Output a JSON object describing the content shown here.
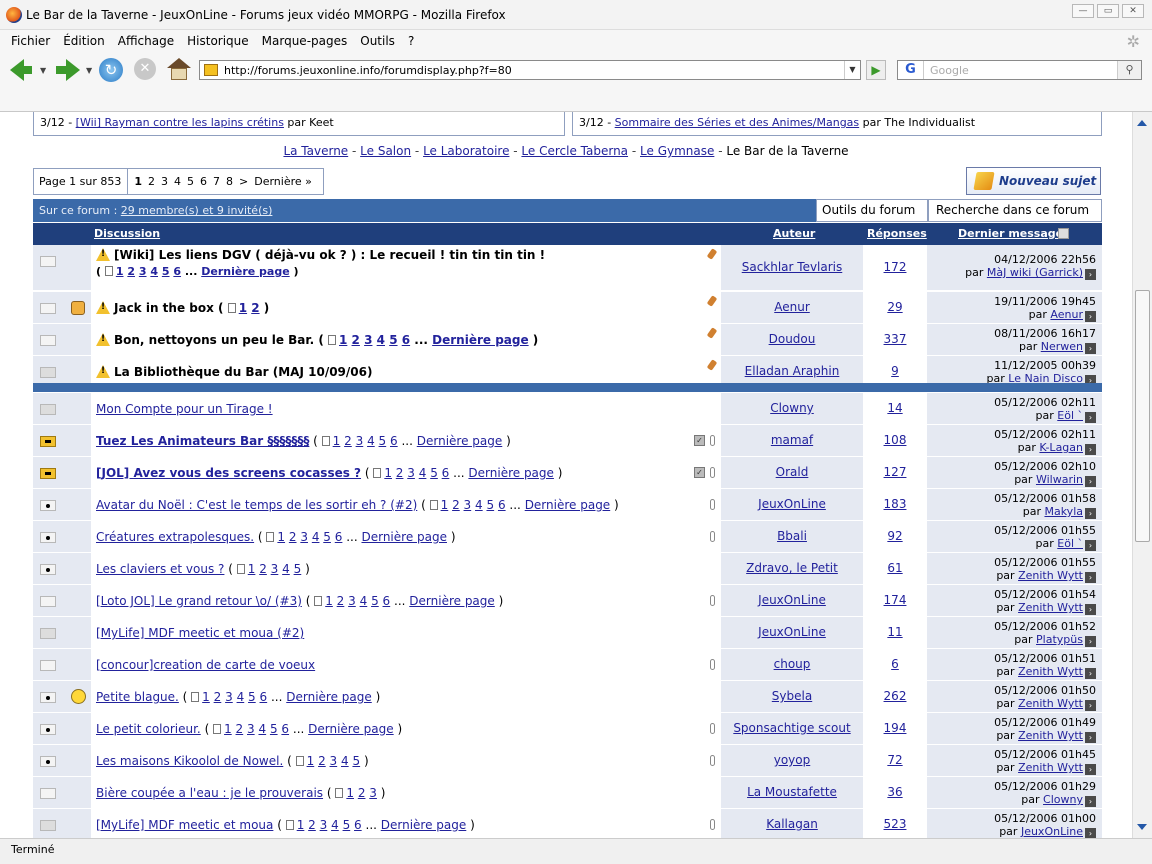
{
  "window": {
    "title": "Le Bar de la Taverne - JeuxOnLine - Forums jeux vidéo MMORPG - Mozilla Firefox"
  },
  "menu": [
    "Fichier",
    "Édition",
    "Affichage",
    "Historique",
    "Marque-pages",
    "Outils",
    "?"
  ],
  "nav": {
    "url": "http://forums.jeuxonline.info/forumdisplay.php?f=80",
    "search_placeholder": "Google",
    "search_engine": "G"
  },
  "status": "Terminé",
  "related": {
    "left": {
      "prefix": "3/12 - ",
      "link": "[Wii] Rayman contre les lapins crétins",
      "by": " par Keet"
    },
    "right": {
      "prefix": "3/12 - ",
      "link": "Sommaire des Séries et des Animes/Mangas",
      "by": " par The Individualist"
    }
  },
  "breadcrumb": [
    "La Taverne",
    "Le Salon",
    "Le Laboratoire",
    "Le Cercle Taberna",
    "Le Gymnase",
    "Le Bar de la Taverne"
  ],
  "breadcrumb_sep": " - ",
  "pager": {
    "label": "Page 1 sur 853",
    "pages": [
      "1",
      "2",
      "3",
      "4",
      "5",
      "6",
      "7",
      "8"
    ],
    "next": ">",
    "last": "Dernière »"
  },
  "new_topic": "Nouveau sujet",
  "forumbar": {
    "prefix": "Sur ce forum : ",
    "link": "29 membre(s) et 9 invité(s)",
    "tools": "Outils du forum",
    "search": "Recherche dans ce forum"
  },
  "columns": {
    "discussion": "Discussion",
    "author": "Auteur",
    "replies": "Réponses",
    "last": "Dernier message"
  },
  "sticky": [
    {
      "title": "[Wiki] Les liens DGV ( déjà-vu ok ? ) : Le recueil ! tin tin tin tin !",
      "pages": "1 2 3 4 5 6 ... Dernière page",
      "author": "Sackhlar Tevlaris",
      "replies": "172",
      "date": "04/12/2006 22h56",
      "last_by": "MàJ wiki (Garrick)"
    },
    {
      "title": "Jack in the box",
      "pages": "1 2",
      "author": "Aenur",
      "replies": "29",
      "date": "19/11/2006 19h45",
      "last_by": "Aenur"
    },
    {
      "title": "Bon, nettoyons un peu le Bar.",
      "pages": "1 2 3 4 5 6 ... Dernière page",
      "author": "Doudou",
      "replies": "337",
      "date": "08/11/2006 16h17",
      "last_by": "Nerwen"
    },
    {
      "title": "La Bibliothèque du Bar (MAJ 10/09/06)",
      "pages": "",
      "author": "Elladan Araphin",
      "replies": "9",
      "date": "11/12/2005 00h39",
      "last_by": "Le Nain Disco"
    }
  ],
  "threads": [
    {
      "title": "Mon Compte pour un Tirage !",
      "pages": "",
      "author": "Clowny",
      "replies": "14",
      "date": "05/12/2006 02h11",
      "last_by": "Eöl `"
    },
    {
      "title": "Tuez Les Animateurs Bar §§§§§§§",
      "pages": "1 2 3 4 5 6 ... Dernière page",
      "author": "mamaf",
      "replies": "108",
      "date": "05/12/2006 02h11",
      "last_by": "K-Lagan"
    },
    {
      "title": "[JOL] Avez vous des screens cocasses ?",
      "pages": "1 2 3 4 5 6 ... Dernière page",
      "author": "Orald",
      "replies": "127",
      "date": "05/12/2006 02h10",
      "last_by": "Wilwarin"
    },
    {
      "title": "Avatar du Noël : C'est le temps de les sortir eh ? (#2)",
      "pages": "1 2 3 4 5 6 ... Dernière page",
      "author": "JeuxOnLine",
      "replies": "183",
      "date": "05/12/2006 01h58",
      "last_by": "Makyla"
    },
    {
      "title": "Créatures extrapolesques.",
      "pages": "1 2 3 4 5 6 ... Dernière page",
      "author": "Bbali",
      "replies": "92",
      "date": "05/12/2006 01h55",
      "last_by": "Eöl `"
    },
    {
      "title": "Les claviers et vous ?",
      "pages": "1 2 3 4 5",
      "author": "Zdravo, le Petit",
      "replies": "61",
      "date": "05/12/2006 01h55",
      "last_by": "Zenith Wytt"
    },
    {
      "title": "[Loto JOL] Le grand retour \\o/ (#3)",
      "pages": "1 2 3 4 5 6 ... Dernière page",
      "author": "JeuxOnLine",
      "replies": "174",
      "date": "05/12/2006 01h54",
      "last_by": "Zenith Wytt"
    },
    {
      "title": "[MyLife] MDF meetic et moua (#2)",
      "pages": "",
      "author": "JeuxOnLine",
      "replies": "11",
      "date": "05/12/2006 01h52",
      "last_by": "Platypüs"
    },
    {
      "title": "[concour]creation de carte de voeux",
      "pages": "",
      "author": "choup",
      "replies": "6",
      "date": "05/12/2006 01h51",
      "last_by": "Zenith Wytt"
    },
    {
      "title": "Petite blague.",
      "pages": "1 2 3 4 5 6 ... Dernière page",
      "author": "Sybela",
      "replies": "262",
      "date": "05/12/2006 01h50",
      "last_by": "Zenith Wytt"
    },
    {
      "title": "Le petit colorieur.",
      "pages": "1 2 3 4 5 6 ... Dernière page",
      "author": "Sponsachtige scout",
      "replies": "194",
      "date": "05/12/2006 01h49",
      "last_by": "Zenith Wytt"
    },
    {
      "title": "Les maisons Kikoolol de Nowel.",
      "pages": "1 2 3 4 5",
      "author": "yoyop",
      "replies": "72",
      "date": "05/12/2006 01h45",
      "last_by": "Zenith Wytt"
    },
    {
      "title": "Bière coupée a l'eau : je le prouverais",
      "pages": "1 2 3",
      "author": "La Moustafette",
      "replies": "36",
      "date": "05/12/2006 01h29",
      "last_by": "Clowny"
    },
    {
      "title": "[MyLife] MDF meetic et moua",
      "pages": "1 2 3 4 5 6 ... Dernière page",
      "author": "Kallagan",
      "replies": "523",
      "date": "05/12/2006 01h00",
      "last_by": "JeuxOnLine"
    }
  ],
  "by_label": "par"
}
